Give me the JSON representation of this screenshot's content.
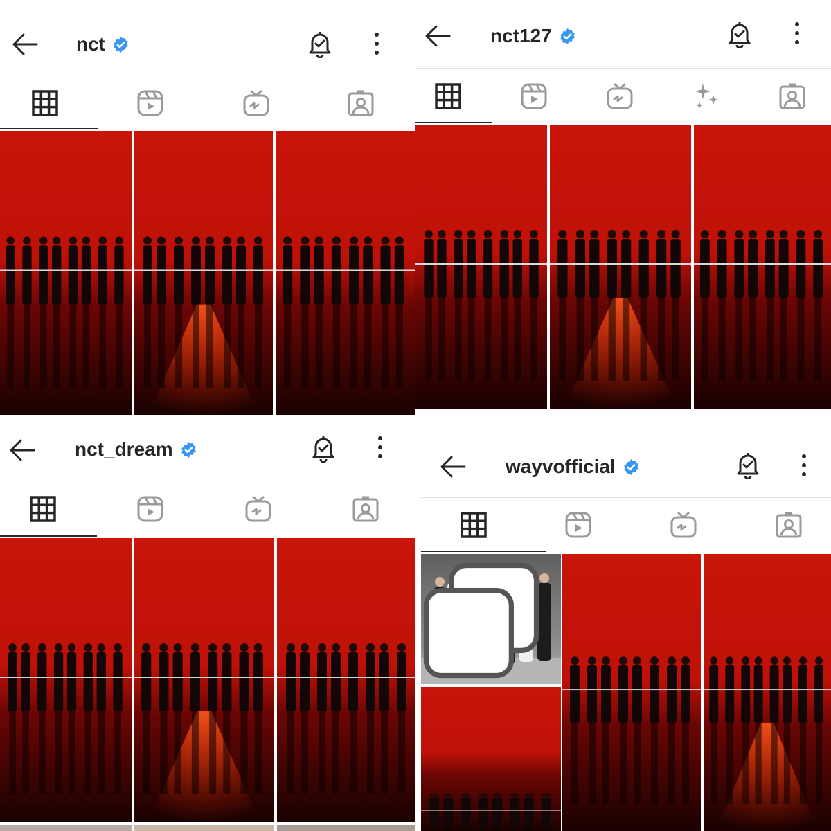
{
  "panels": [
    {
      "username": "nct",
      "verified": true,
      "tabs": [
        "grid",
        "reels",
        "igtv",
        "tagged"
      ],
      "active_tab": "grid"
    },
    {
      "username": "nct127",
      "verified": true,
      "tabs": [
        "grid",
        "reels",
        "igtv",
        "guides",
        "tagged"
      ],
      "active_tab": "grid"
    },
    {
      "username": "nct_dream",
      "verified": true,
      "tabs": [
        "grid",
        "reels",
        "igtv",
        "tagged"
      ],
      "active_tab": "grid"
    },
    {
      "username": "wayvofficial",
      "verified": true,
      "tabs": [
        "grid",
        "reels",
        "igtv",
        "tagged"
      ],
      "active_tab": "grid"
    }
  ],
  "icons": {
    "back": "back-arrow-icon",
    "verified": "verified-badge-icon",
    "notifications": "bell-check-icon",
    "more": "more-options-icon",
    "grid": "grid-icon",
    "reels": "reels-icon",
    "igtv": "igtv-icon",
    "guides": "sparkle-icon",
    "tagged": "tagged-icon",
    "multi": "carousel-icon"
  },
  "colors": {
    "verified": "#3897f0",
    "text": "#262626",
    "icon": "#262626",
    "inactive_icon": "#9a9a9a",
    "divider": "#e3e3e3",
    "photo_red": "#c21208"
  }
}
